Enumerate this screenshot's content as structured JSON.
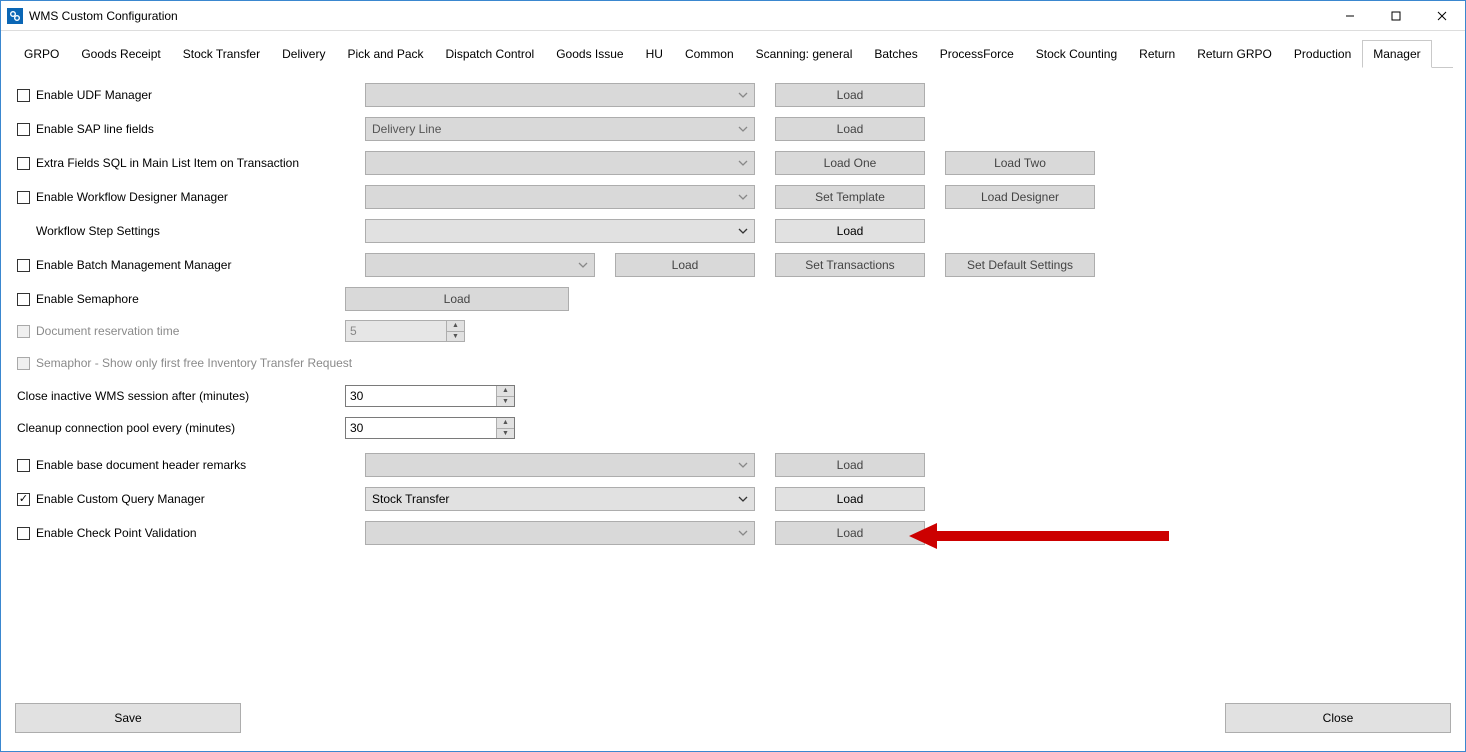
{
  "window": {
    "title": "WMS Custom Configuration"
  },
  "tabs": [
    "GRPO",
    "Goods Receipt",
    "Stock Transfer",
    "Delivery",
    "Pick and Pack",
    "Dispatch Control",
    "Goods Issue",
    "HU",
    "Common",
    "Scanning: general",
    "Batches",
    "ProcessForce",
    "Stock Counting",
    "Return",
    "Return GRPO",
    "Production",
    "Manager"
  ],
  "active_tab": "Manager",
  "rows": {
    "r1": {
      "label": "Enable UDF Manager",
      "btn1": "Load"
    },
    "r2": {
      "label": "Enable SAP line fields",
      "combo": "Delivery Line",
      "btn1": "Load"
    },
    "r3": {
      "label": "Extra Fields SQL in Main List Item on Transaction",
      "btn1": "Load One",
      "btn2": "Load Two"
    },
    "r4": {
      "label": "Enable Workflow Designer Manager",
      "btn1": "Set Template",
      "btn2": "Load Designer"
    },
    "r5": {
      "label": "Workflow Step Settings",
      "btn1": "Load"
    },
    "r6": {
      "label": "Enable Batch Management Manager",
      "btn1": "Load",
      "btn2": "Set Transactions",
      "btn3": "Set Default Settings"
    },
    "r7": {
      "label": "Enable Semaphore",
      "btn1": "Load"
    },
    "r8": {
      "label": "Document reservation time",
      "value": "5"
    },
    "r9": {
      "label": "Semaphor - Show only first free Inventory Transfer Request"
    },
    "r10": {
      "label": "Close inactive WMS session after (minutes)",
      "value": "30"
    },
    "r11": {
      "label": "Cleanup connection pool every (minutes)",
      "value": "30"
    },
    "r12": {
      "label": "Enable base document header remarks",
      "btn1": "Load"
    },
    "r13": {
      "label": "Enable Custom Query Manager",
      "combo": "Stock Transfer",
      "btn1": "Load"
    },
    "r14": {
      "label": "Enable Check Point Validation",
      "btn1": "Load"
    }
  },
  "footer": {
    "save": "Save",
    "close": "Close"
  }
}
